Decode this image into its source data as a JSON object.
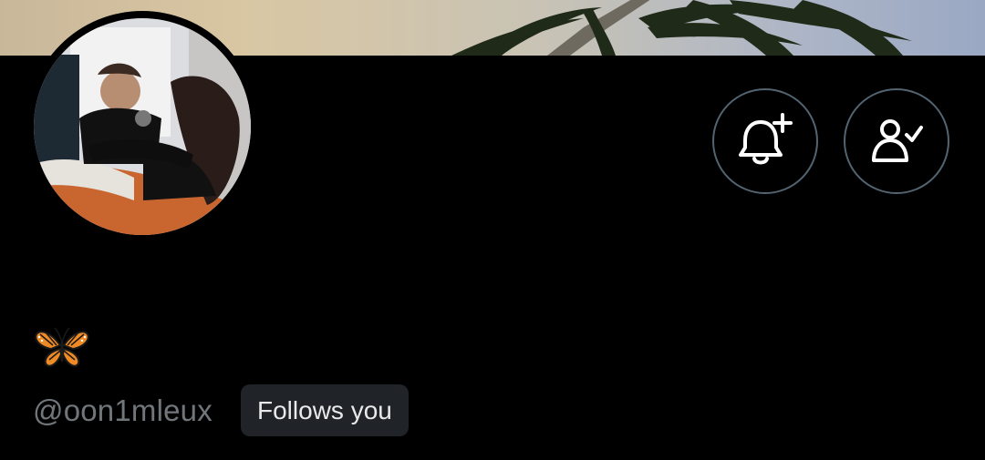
{
  "profile": {
    "banner_icon": "palm-tree-photo",
    "avatar_icon": "profile-photo",
    "bio_emoji": "🦋",
    "bio_emoji_name": "butterfly-icon",
    "handle": "@oon1mleux",
    "follows_badge": "Follows you"
  },
  "actions": {
    "notify_icon": "bell-plus-icon",
    "following_icon": "person-check-icon"
  },
  "colors": {
    "background": "#000000",
    "button_border": "#536471",
    "handle_text": "#71767b",
    "badge_bg": "#202327",
    "badge_text": "#e7e9ea"
  }
}
